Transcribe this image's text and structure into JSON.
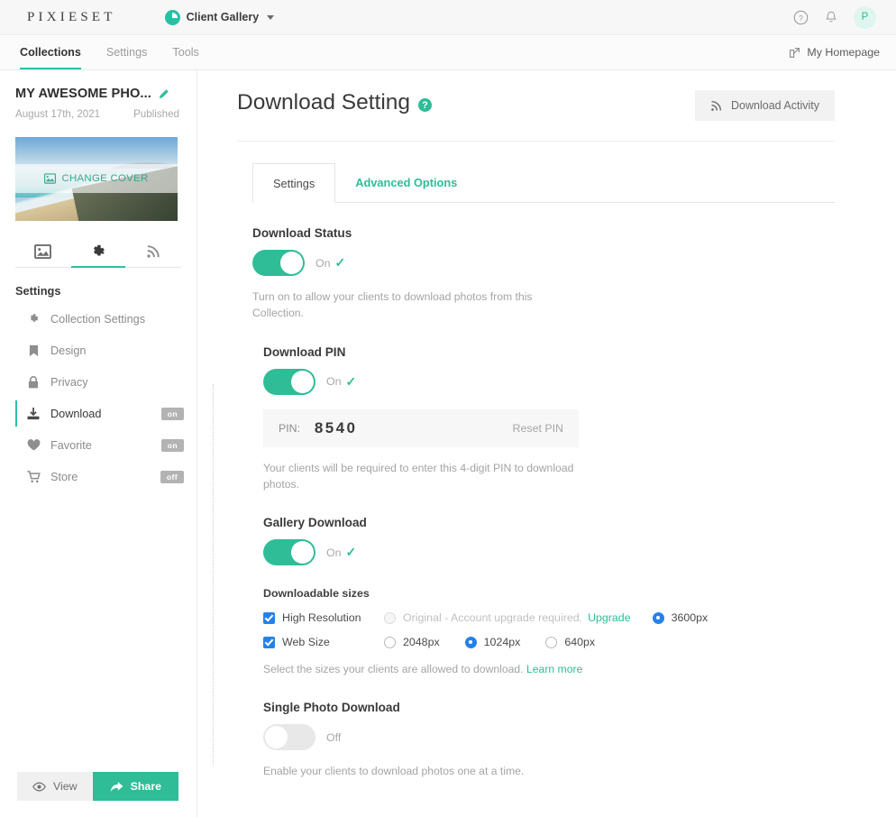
{
  "topbar": {
    "brand": "PIXIESET",
    "workspace": "Client Gallery",
    "help_icon": "question-circle-icon",
    "bell_icon": "bell-icon",
    "avatar_initial": "P"
  },
  "nav": {
    "items": [
      {
        "label": "Collections",
        "active": true
      },
      {
        "label": "Settings",
        "active": false
      },
      {
        "label": "Tools",
        "active": false
      }
    ],
    "homepage_label": "My Homepage"
  },
  "sidebar": {
    "collection_title": "MY AWESOME PHO...",
    "date": "August 17th, 2021",
    "status": "Published",
    "cover_action": "CHANGE COVER",
    "icon_tabs": [
      "photos-icon",
      "gear-icon",
      "rss-icon"
    ],
    "section_label": "Settings",
    "items": [
      {
        "label": "Collection Settings",
        "icon": "gear-icon",
        "badge": "",
        "active": false
      },
      {
        "label": "Design",
        "icon": "bookmark-icon",
        "badge": "",
        "active": false
      },
      {
        "label": "Privacy",
        "icon": "lock-icon",
        "badge": "",
        "active": false
      },
      {
        "label": "Download",
        "icon": "download-icon",
        "badge": "on",
        "active": true
      },
      {
        "label": "Favorite",
        "icon": "heart-icon",
        "badge": "on",
        "active": false
      },
      {
        "label": "Store",
        "icon": "cart-icon",
        "badge": "off",
        "active": false
      }
    ],
    "view_button": "View",
    "share_button": "Share"
  },
  "main": {
    "title": "Download Setting",
    "help_badge": "?",
    "download_activity": "Download Activity",
    "tabs": [
      {
        "label": "Settings",
        "active": true
      },
      {
        "label": "Advanced Options",
        "active": false
      }
    ],
    "download_status": {
      "title": "Download Status",
      "state": "On",
      "enabled": true,
      "hint": "Turn on to allow your clients to download photos from this Collection."
    },
    "download_pin": {
      "title": "Download PIN",
      "state": "On",
      "enabled": true,
      "pin_label": "PIN:",
      "pin_value": "8540",
      "reset_label": "Reset PIN",
      "hint": "Your clients will be required to enter this 4-digit PIN to download photos."
    },
    "gallery_download": {
      "title": "Gallery Download",
      "state": "On",
      "enabled": true,
      "sizes_label": "Downloadable sizes",
      "high_res": {
        "label": "High Resolution",
        "checked": true,
        "original_label": "Original - Account upgrade required.",
        "original_selected": false,
        "upgrade_link": "Upgrade",
        "px_label": "3600px",
        "px_selected": true
      },
      "web_size": {
        "label": "Web Size",
        "checked": true,
        "options": [
          {
            "label": "2048px",
            "selected": false
          },
          {
            "label": "1024px",
            "selected": true
          },
          {
            "label": "640px",
            "selected": false
          }
        ]
      },
      "hint": "Select the sizes your clients are allowed to download.",
      "learn_more": "Learn more"
    },
    "single_photo": {
      "title": "Single Photo Download",
      "state": "Off",
      "enabled": false,
      "hint": "Enable your clients to download photos one at a time."
    }
  },
  "colors": {
    "accent_teal": "#2ebd97",
    "radio_blue": "#2680eb",
    "text_dark": "#3a3a3a",
    "text_muted": "#a4a4a4"
  }
}
